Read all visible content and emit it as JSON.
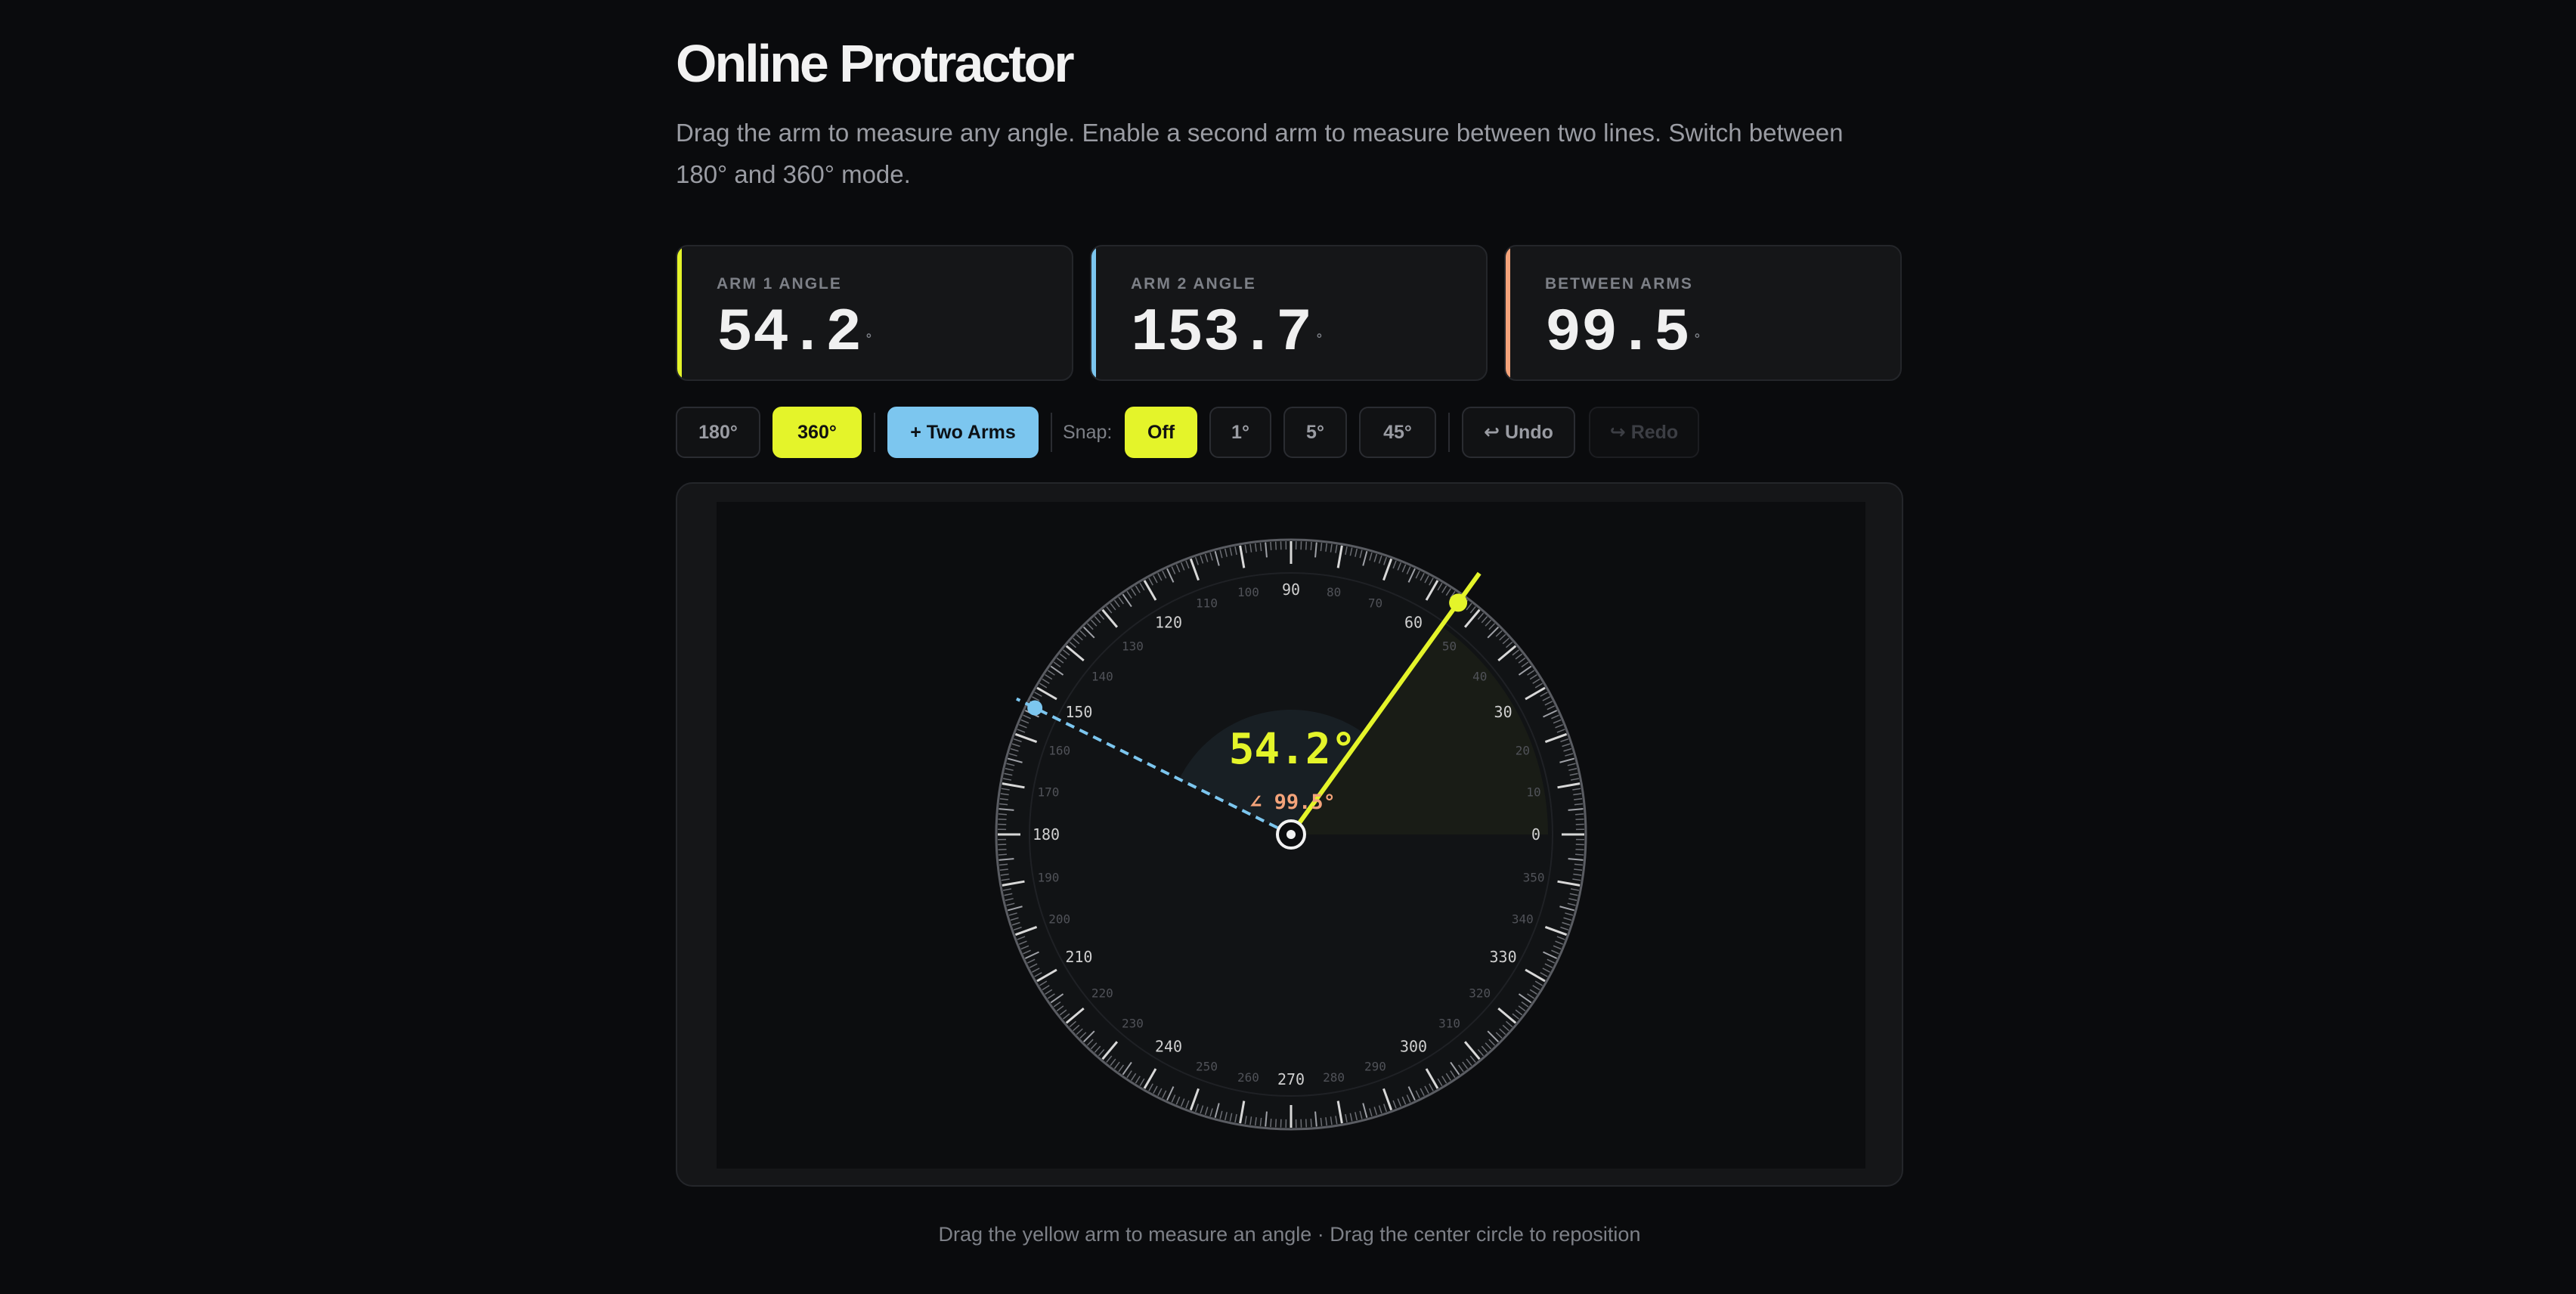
{
  "page": {
    "title": "Online Protractor",
    "description": "Drag the arm to measure any angle. Enable a second arm to measure between two lines. Switch between 180° and 360° mode.",
    "footer": "Drag the yellow arm to measure an angle · Drag the center circle to reposition"
  },
  "readouts": [
    {
      "label": "ARM 1 ANGLE",
      "value": "54.2",
      "unit": "°",
      "color": "#e4f42a"
    },
    {
      "label": "ARM 2 ANGLE",
      "value": "153.7",
      "unit": "°",
      "color": "#7cc6ef"
    },
    {
      "label": "BETWEEN ARMS",
      "value": "99.5",
      "unit": "°",
      "color": "#f4a37a"
    }
  ],
  "toolbar": {
    "mode_180": "180°",
    "mode_360": "360°",
    "two_arms": "+ Two Arms",
    "snap_label": "Snap:",
    "snap_off": "Off",
    "snap_1": "1°",
    "snap_5": "5°",
    "snap_45": "45°",
    "undo": "↩ Undo",
    "redo": "↪ Redo",
    "active_mode": "360°",
    "active_snap": "Off"
  },
  "protractor": {
    "arm1_angle": 54.2,
    "arm2_angle": 153.7,
    "center_label": "54.2°",
    "between_label": "∠ 99.5°",
    "arm1_color": "#e4f42a",
    "arm2_color": "#7cc6ef",
    "between_color": "#f4a37a",
    "major_labels": [
      "0",
      "30",
      "60",
      "90",
      "120",
      "150",
      "180",
      "210",
      "240",
      "270",
      "300",
      "330"
    ],
    "minor_labels": [
      "10",
      "20",
      "40",
      "50",
      "70",
      "80",
      "100",
      "110",
      "130",
      "140",
      "160",
      "170",
      "190",
      "200",
      "220",
      "230",
      "250",
      "260",
      "280",
      "290",
      "310",
      "320",
      "340",
      "350"
    ]
  }
}
